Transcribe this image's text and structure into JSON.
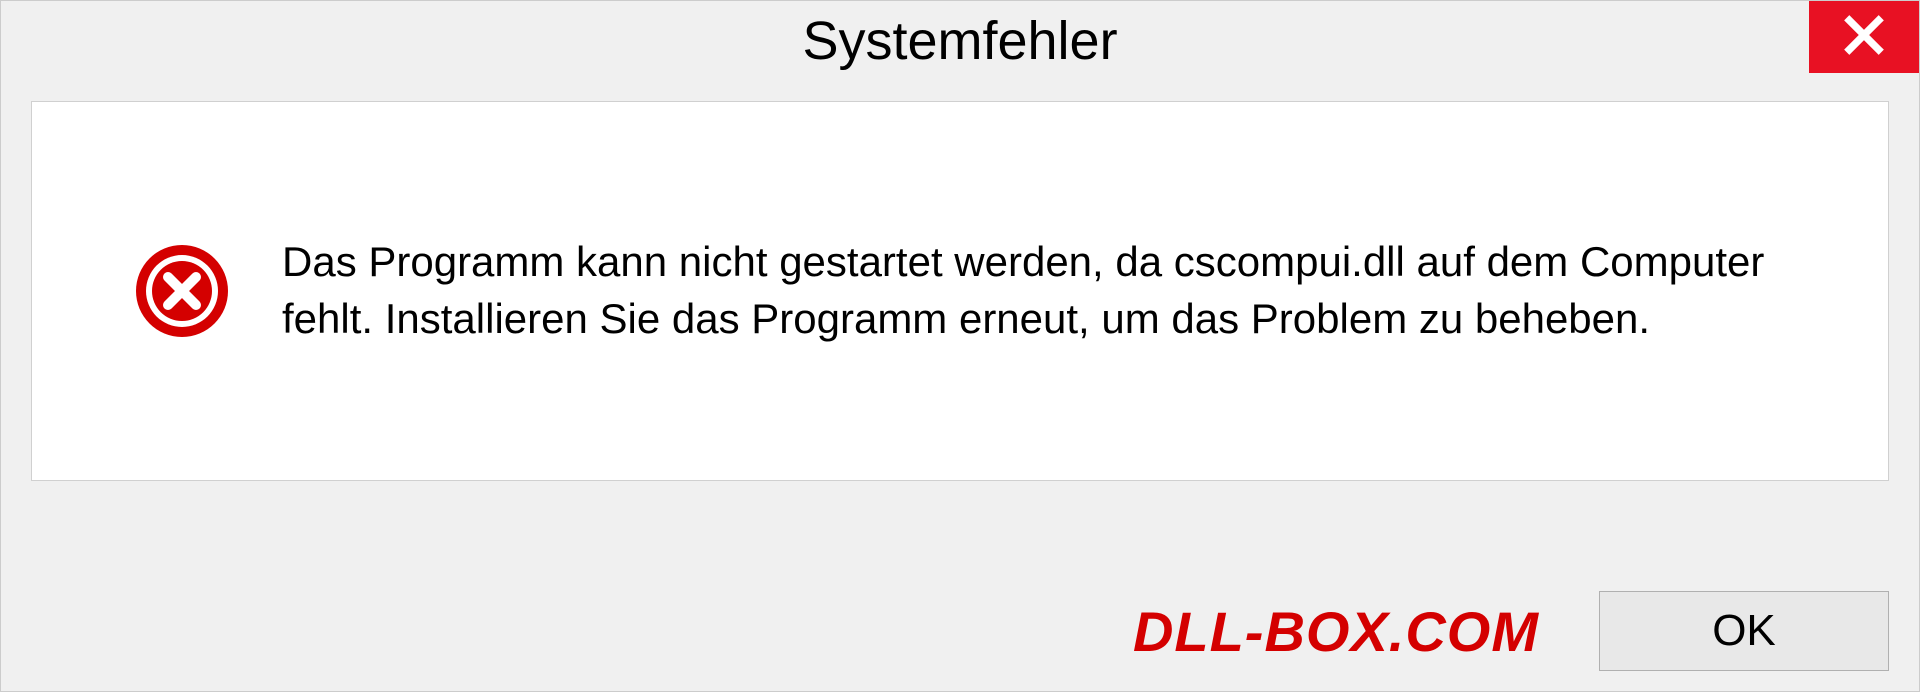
{
  "dialog": {
    "title": "Systemfehler",
    "message": "Das Programm kann nicht gestartet werden, da cscompui.dll auf dem Computer fehlt. Installieren Sie das Programm erneut, um das Problem zu beheben.",
    "ok_label": "OK"
  },
  "watermark": {
    "text": "DLL-BOX.COM"
  }
}
